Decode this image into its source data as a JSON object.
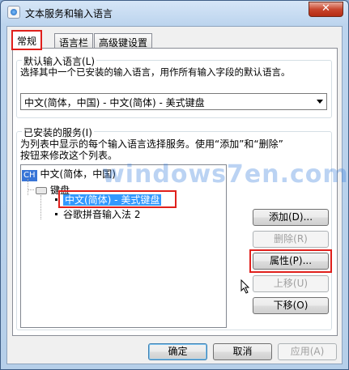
{
  "window": {
    "title": "文本服务和输入语言",
    "close_label": "✕"
  },
  "tabs": [
    {
      "label": "常规"
    },
    {
      "label": "语言栏"
    },
    {
      "label": "高级键设置"
    }
  ],
  "default_language": {
    "group_label": "默认输入语言(L)",
    "description": "选择其中一个已安装的输入语言，用作所有输入字段的默认语言。",
    "selected": "中文(简体，中国) - 中文(简体) - 美式键盘"
  },
  "installed_services": {
    "group_label": "已安装的服务(I)",
    "description_line1": "为列表中显示的每个输入语言选择服务。使用“添加”和“删除”",
    "description_line2": "按钮来修改这个列表。",
    "tree": {
      "language": {
        "badge": "CH",
        "label": "中文(简体，中国)"
      },
      "category": "键盘",
      "items": [
        {
          "label": "中文(简体) - 美式键盘",
          "selected": true
        },
        {
          "label": "谷歌拼音输入法 2",
          "selected": false
        }
      ]
    },
    "buttons": {
      "add": "添加(D)...",
      "remove": "删除(R)",
      "properties": "属性(P)...",
      "move_up": "上移(U)",
      "move_down": "下移(O)"
    }
  },
  "footer": {
    "ok": "确定",
    "cancel": "取消",
    "apply": "应用(A)"
  },
  "watermark": "windows7en.com",
  "colors": {
    "highlight_red": "#e0201c",
    "selection_blue": "#3399ff"
  }
}
